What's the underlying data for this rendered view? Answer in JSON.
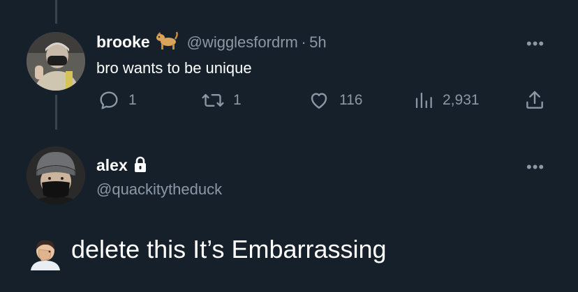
{
  "tweet": {
    "display_name": "brooke",
    "name_emoji_icon": "dog-emoji-icon",
    "handle": "@wigglesfordrm",
    "separator": "·",
    "time": "5h",
    "text": "bro wants to be unique",
    "replies": "1",
    "retweets": "1",
    "likes": "116",
    "views": "2,931"
  },
  "reply": {
    "display_name": "alex",
    "lock_icon": "lock-icon",
    "handle": "@quackitytheduck",
    "text": "delete this It’s Embarrassing",
    "emoji_icon": "facepalm-emoji-icon"
  },
  "more_label": "•••",
  "colors": {
    "background": "#15202b",
    "text": "#ffffff",
    "secondary": "#8b98a5",
    "thread_line": "#38444d"
  }
}
